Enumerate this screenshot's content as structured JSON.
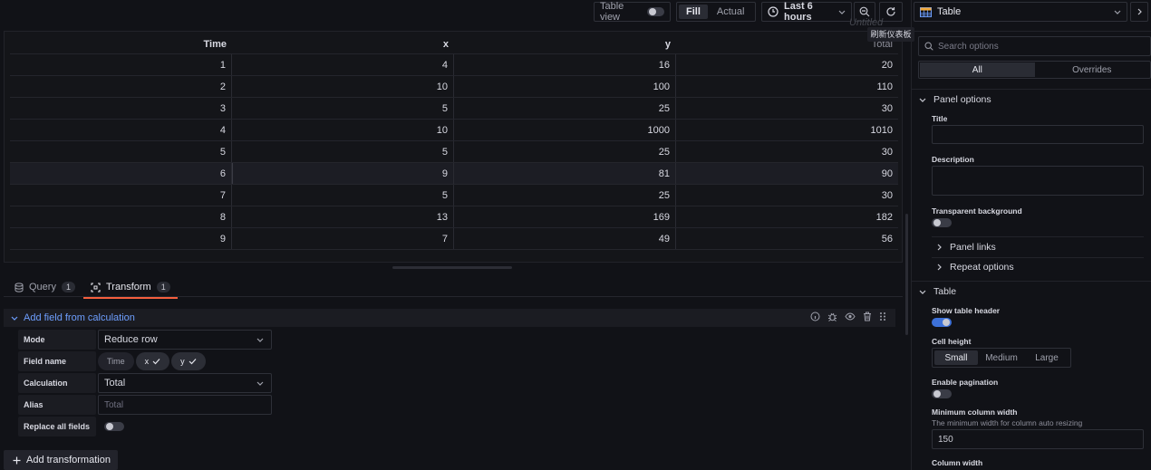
{
  "toolbar": {
    "table_view_label": "Table view",
    "fill_label": "Fill",
    "actual_label": "Actual",
    "time_range": "Last 6 hours",
    "untitled": "Untitled",
    "refresh_tooltip": "刷新仪表板"
  },
  "table": {
    "headers": [
      "Time",
      "x",
      "y",
      "Total"
    ],
    "rows": [
      [
        "1",
        "4",
        "16",
        "20"
      ],
      [
        "2",
        "10",
        "100",
        "110"
      ],
      [
        "3",
        "5",
        "25",
        "30"
      ],
      [
        "4",
        "10",
        "1000",
        "1010"
      ],
      [
        "5",
        "5",
        "25",
        "30"
      ],
      [
        "6",
        "9",
        "81",
        "90"
      ],
      [
        "7",
        "5",
        "25",
        "30"
      ],
      [
        "8",
        "13",
        "169",
        "182"
      ],
      [
        "9",
        "7",
        "49",
        "56"
      ]
    ]
  },
  "tabs": [
    {
      "label": "Query",
      "count": "1"
    },
    {
      "label": "Transform",
      "count": "1"
    }
  ],
  "transform": {
    "title": "Add field from calculation",
    "mode_label": "Mode",
    "mode_value": "Reduce row",
    "field_name_label": "Field name",
    "fields": [
      "Time",
      "x",
      "y"
    ],
    "calculation_label": "Calculation",
    "calculation_value": "Total",
    "alias_label": "Alias",
    "alias_placeholder": "Total",
    "replace_label": "Replace all fields",
    "add_button": "Add transformation"
  },
  "options": {
    "viz_name": "Table",
    "search_placeholder": "Search options",
    "all_label": "All",
    "overrides_label": "Overrides",
    "panel_options": "Panel options",
    "title_label": "Title",
    "description_label": "Description",
    "transparent_label": "Transparent background",
    "panel_links": "Panel links",
    "repeat_options": "Repeat options",
    "table_section": "Table",
    "show_header_label": "Show table header",
    "cell_height_label": "Cell height",
    "cell_heights": [
      "Small",
      "Medium",
      "Large"
    ],
    "pagination_label": "Enable pagination",
    "min_col_width_label": "Minimum column width",
    "min_col_width_desc": "The minimum width for column auto resizing",
    "min_col_width_value": "150",
    "col_width_label": "Column width"
  },
  "colors": {
    "accent": "#6e9fff",
    "tab_underline": "#f55f3e",
    "toggle_on": "#3d71d9"
  }
}
